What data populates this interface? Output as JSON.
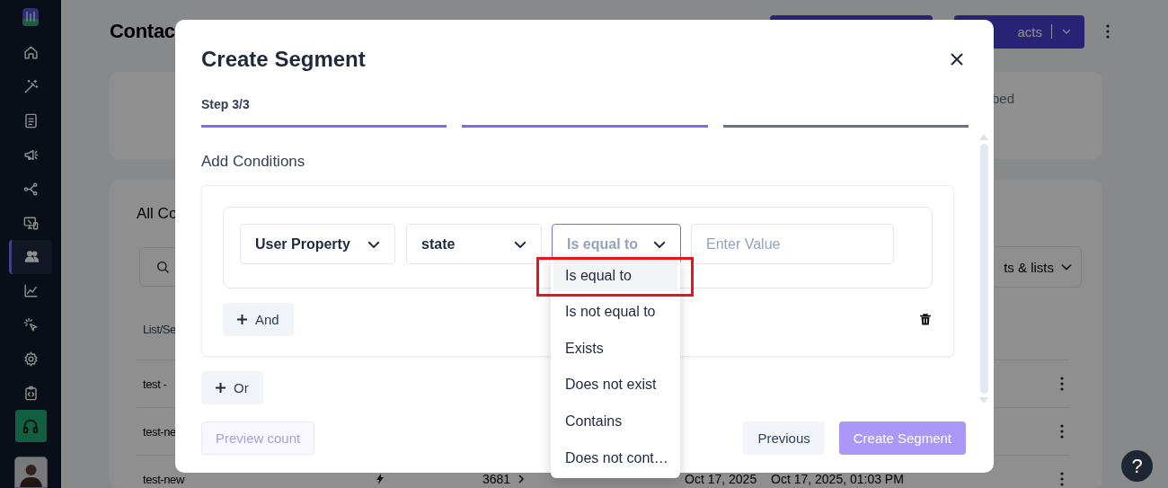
{
  "sidebar": {
    "items": [
      {
        "kind": "home",
        "selected": false
      },
      {
        "kind": "wand",
        "selected": false
      },
      {
        "kind": "document",
        "selected": false
      },
      {
        "kind": "megaphone",
        "selected": false
      },
      {
        "kind": "share",
        "selected": false
      },
      {
        "kind": "devices",
        "selected": false
      },
      {
        "kind": "users",
        "selected": true
      },
      {
        "kind": "chart",
        "selected": false
      },
      {
        "kind": "cursor",
        "selected": false
      },
      {
        "kind": "settings",
        "selected": false
      },
      {
        "kind": "code",
        "selected": false
      },
      {
        "kind": "support",
        "selected": false
      }
    ]
  },
  "page": {
    "title": "Contac",
    "header_buttons": [
      {
        "kind": "plain"
      },
      {
        "kind": "split",
        "label": "acts"
      }
    ],
    "stats_card": {
      "label": "bed"
    },
    "contacts_card": {
      "title": "All Co",
      "filter": "ts & lists",
      "columns": [
        "List/Se"
      ],
      "rows": [
        {
          "name": "test -"
        },
        {
          "name": "test-ne"
        },
        {
          "name": "test-new",
          "column_3": "3681",
          "column_4": "Oct 17, 2025",
          "column_5": "Oct 17, 2025, 01:03 PM"
        }
      ]
    }
  },
  "dialog": {
    "title": "Create Segment",
    "step": "Step 3/3",
    "progress": [
      {
        "complete": true
      },
      {
        "complete": true
      },
      {
        "complete": false
      }
    ],
    "section": "Add Conditions",
    "condition": {
      "property_type": "User Property",
      "property": "state",
      "operator": {
        "placeholder": "Is equal to",
        "open": true
      },
      "value": {
        "placeholder": "Enter Value"
      }
    },
    "and_button": "And",
    "or_button": "Or",
    "operator_options": [
      {
        "label": "Is equal to",
        "selected": true
      },
      {
        "label": "Is not equal to",
        "selected": false
      },
      {
        "label": "Exists",
        "selected": false
      },
      {
        "label": "Does not exist",
        "selected": false
      },
      {
        "label": "Contains",
        "selected": false
      },
      {
        "label": "Does not cont…",
        "selected": false
      }
    ],
    "buttons": [
      {
        "label": "Preview count",
        "kind": "secondary",
        "disabled": true
      },
      {
        "label": "Previous",
        "kind": "secondary",
        "disabled": false
      },
      {
        "label": "Create Segment",
        "kind": "primary",
        "disabled": true
      }
    ]
  },
  "help_button": {
    "label": "?"
  }
}
